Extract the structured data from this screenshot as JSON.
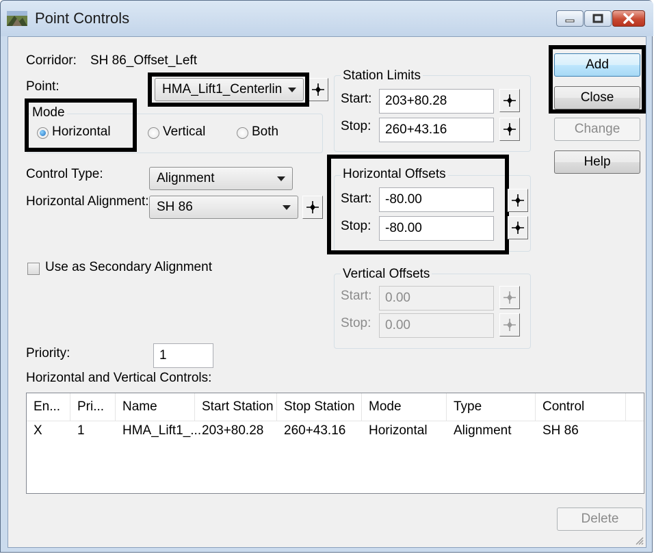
{
  "window": {
    "title": "Point Controls"
  },
  "corridor": {
    "label": "Corridor:",
    "value": "SH 86_Offset_Left"
  },
  "point": {
    "label": "Point:",
    "value": "HMA_Lift1_Centerlin"
  },
  "mode": {
    "title": "Mode",
    "options": [
      "Horizontal",
      "Vertical",
      "Both"
    ],
    "selected": "Horizontal"
  },
  "station_limits": {
    "title": "Station Limits",
    "start_label": "Start:",
    "start_value": "203+80.28",
    "stop_label": "Stop:",
    "stop_value": "260+43.16"
  },
  "control_type": {
    "label": "Control Type:",
    "value": "Alignment"
  },
  "horizontal_alignment": {
    "label": "Horizontal Alignment:",
    "value": "SH 86"
  },
  "horizontal_offsets": {
    "title": "Horizontal Offsets",
    "start_label": "Start:",
    "start_value": "-80.00",
    "stop_label": "Stop:",
    "stop_value": "-80.00"
  },
  "secondary": {
    "label": "Use as Secondary Alignment",
    "checked": false
  },
  "vertical_offsets": {
    "title": "Vertical Offsets",
    "start_label": "Start:",
    "start_value": "0.00",
    "stop_label": "Stop:",
    "stop_value": "0.00"
  },
  "priority": {
    "label": "Priority:",
    "value": "1"
  },
  "controls_list": {
    "label": "Horizontal and Vertical Controls:",
    "columns": [
      "En...",
      "Pri...",
      "Name",
      "Start Station",
      "Stop Station",
      "Mode",
      "Type",
      "Control"
    ],
    "rows": [
      [
        "X",
        "1",
        "HMA_Lift1_...",
        "203+80.28",
        "260+43.16",
        "Horizontal",
        "Alignment",
        "SH 86"
      ]
    ]
  },
  "buttons": {
    "add": "Add",
    "close": "Close",
    "change": "Change",
    "help": "Help",
    "delete": "Delete"
  },
  "colors": {
    "callout": "#000000",
    "titlebar": "#c3d5ea",
    "close_button": "#c84a32",
    "default_button": "#bee6fd"
  },
  "icons": [
    "app-icon",
    "minimize-icon",
    "maximize-icon",
    "close-icon",
    "crosshair-icon",
    "resize-grip-icon"
  ]
}
